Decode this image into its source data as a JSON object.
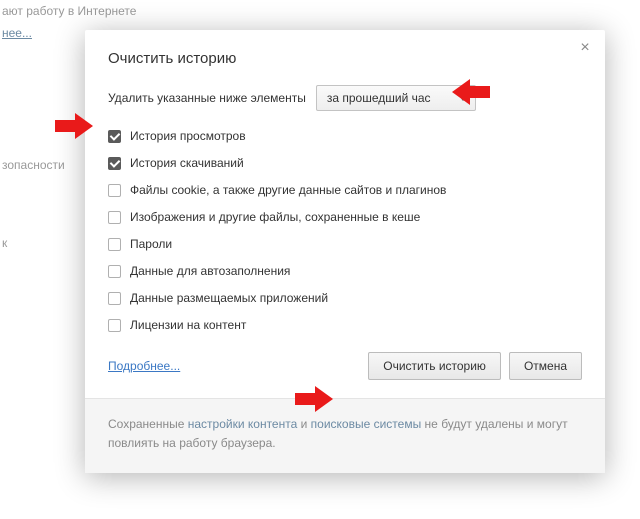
{
  "background": {
    "line1": "ают работу в Интернете",
    "linkMore": "нее...",
    "security": "зопасности",
    "letterK": "к"
  },
  "dialog": {
    "title": "Очистить историю",
    "periodLabel": "Удалить указанные ниже элементы",
    "periodSelected": "за прошедший час",
    "checks": [
      {
        "label": "История просмотров",
        "checked": true
      },
      {
        "label": "История скачиваний",
        "checked": true
      },
      {
        "label": "Файлы cookie, а также другие данные сайтов и плагинов",
        "checked": false
      },
      {
        "label": "Изображения и другие файлы, сохраненные в кеше",
        "checked": false
      },
      {
        "label": "Пароли",
        "checked": false
      },
      {
        "label": "Данные для автозаполнения",
        "checked": false
      },
      {
        "label": "Данные размещаемых приложений",
        "checked": false
      },
      {
        "label": "Лицензии на контент",
        "checked": false
      }
    ],
    "moreLink": "Подробнее...",
    "clearBtn": "Очистить историю",
    "cancelBtn": "Отмена",
    "footer": {
      "t1": "Сохраненные ",
      "l1": "настройки контента",
      "t2": " и ",
      "l2": "поисковые системы",
      "t3": " не будут удалены и могут повлиять на работу браузера."
    }
  }
}
